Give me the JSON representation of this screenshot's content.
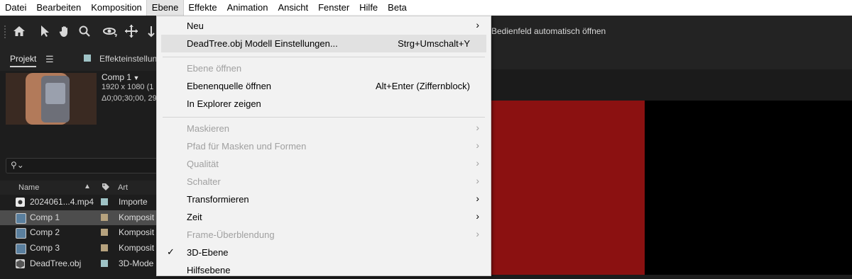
{
  "menubar": [
    "Datei",
    "Bearbeiten",
    "Komposition",
    "Ebene",
    "Effekte",
    "Animation",
    "Ansicht",
    "Fenster",
    "Hilfe",
    "Beta"
  ],
  "toolbar": {
    "icons": [
      "home-icon",
      "selection-arrow-icon",
      "hand-icon",
      "zoom-icon",
      "orbit-camera-icon",
      "pan-camera-icon",
      "dolly-camera-icon"
    ],
    "auto_open_label": "Bedienfeld automatisch öffnen"
  },
  "panels": {
    "project_tab": "Projekt",
    "effects_tab": "Effekteinstellun"
  },
  "comp_preview": {
    "name": "Comp 1",
    "info1": "1920 x 1080 (1",
    "info2": "Δ0;00;30;00, 29"
  },
  "search": {
    "icon": "search-icon"
  },
  "columns": {
    "name": "Name",
    "type": "Art"
  },
  "items": [
    {
      "name": "2024061...4.mp4",
      "type": "Importe",
      "icon": "footage-icon",
      "color": "#9fc3c6",
      "selected": false
    },
    {
      "name": "Comp 1",
      "type": "Komposit",
      "icon": "composition-icon",
      "color": "#b6a27e",
      "selected": true
    },
    {
      "name": "Comp 2",
      "type": "Komposit",
      "icon": "composition-icon",
      "color": "#b6a27e",
      "selected": false
    },
    {
      "name": "Comp 3",
      "type": "Komposit",
      "icon": "composition-icon",
      "color": "#b6a27e",
      "selected": false
    },
    {
      "name": "DeadTree.obj",
      "type": "3D-Mode",
      "icon": "3d-model-icon",
      "color": "#9fc3c6",
      "selected": false
    }
  ],
  "menu": [
    {
      "label": "Neu",
      "shortcut": "",
      "submenu": true,
      "disabled": false
    },
    {
      "label": "DeadTree.obj Modell Einstellungen...",
      "shortcut": "Strg+Umschalt+Y",
      "submenu": false,
      "disabled": false,
      "highlighted": true
    },
    {
      "label": "Ebene öffnen",
      "shortcut": "",
      "submenu": false,
      "disabled": true
    },
    {
      "label": "Ebenenquelle öffnen",
      "shortcut": "Alt+Enter (Ziffernblock)",
      "submenu": false,
      "disabled": false
    },
    {
      "label": "In Explorer zeigen",
      "shortcut": "",
      "submenu": false,
      "disabled": false
    },
    {
      "label": "Maskieren",
      "shortcut": "",
      "submenu": true,
      "disabled": true
    },
    {
      "label": "Pfad für Masken und Formen",
      "shortcut": "",
      "submenu": true,
      "disabled": true
    },
    {
      "label": "Qualität",
      "shortcut": "",
      "submenu": true,
      "disabled": true
    },
    {
      "label": "Schalter",
      "shortcut": "",
      "submenu": true,
      "disabled": true
    },
    {
      "label": "Transformieren",
      "shortcut": "",
      "submenu": true,
      "disabled": false
    },
    {
      "label": "Zeit",
      "shortcut": "",
      "submenu": true,
      "disabled": false
    },
    {
      "label": "Frame-Überblendung",
      "shortcut": "",
      "submenu": true,
      "disabled": true
    },
    {
      "label": "3D-Ebene",
      "shortcut": "",
      "submenu": false,
      "disabled": false,
      "checked": true
    },
    {
      "label": "Hilfsebene",
      "shortcut": "",
      "submenu": false,
      "disabled": false
    }
  ],
  "colors": {
    "accent_red": "#8b1111",
    "menu_bg": "#f2f2f2",
    "app_bg": "#1d1d1d"
  }
}
